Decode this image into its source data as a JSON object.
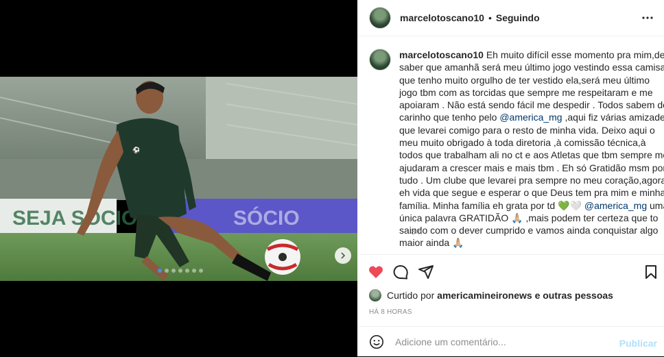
{
  "post": {
    "username": "marcelotoscano10",
    "follow_status": "Seguindo",
    "caption": {
      "parts": [
        "Eh muito difícil esse momento pra mim,de saber que amanhã será meu último jogo vestindo essa camisa que tenho muito orgulho de ter vestido ela,será meu último jogo tbm com as torcidas que sempre me respeitaram e me apoiaram . Não está sendo fácil me despedir . Todos sabem do carinho que tenho pelo ",
        "@america_mg",
        " ,aqui fiz várias amizades que levarei comigo para o resto de minha vida. Deixo aqui o meu muito obrigado à toda diretoria ,à comissão técnica,à todos que trabalham ali no ct e aos Atletas que tbm sempre me ajudaram a crescer mais e mais tbm . Eh só Gratidão msm por tudo . Um clube que levarei pra sempre no meu coração,agora eh vida que segue e esperar o que Deus tem pra mim e minha família. Minha família eh grata por td 💚🤍 ",
        "@america_mg",
        " uma única palavra GRATIDÃO 🙏🏼 ,mais podem ter certeza que to saindo com o dever cumprido e vamos ainda conquistar algo maior ainda 🙏🏼"
      ],
      "time": "8 h"
    },
    "likes": {
      "prefix": "Curtido por",
      "user": "americamineironews",
      "suffix": "e outras pessoas"
    },
    "date": "HÁ 8 HORAS",
    "comment_placeholder": "Adicione um comentário...",
    "publish_label": "Publicar",
    "liked": true,
    "like_color": "#ed4956",
    "carousel": {
      "slide_count": 7,
      "active_slide": 1
    },
    "photo_text": {
      "banner_left": "SEJA SÓCIO",
      "banner_right": "SÓCIO"
    }
  },
  "icons": {
    "more": "more-options-icon",
    "like": "heart-icon",
    "comment": "comment-icon",
    "share": "share-icon",
    "save": "bookmark-icon",
    "emoji": "emoji-icon",
    "next": "chevron-right-icon"
  }
}
